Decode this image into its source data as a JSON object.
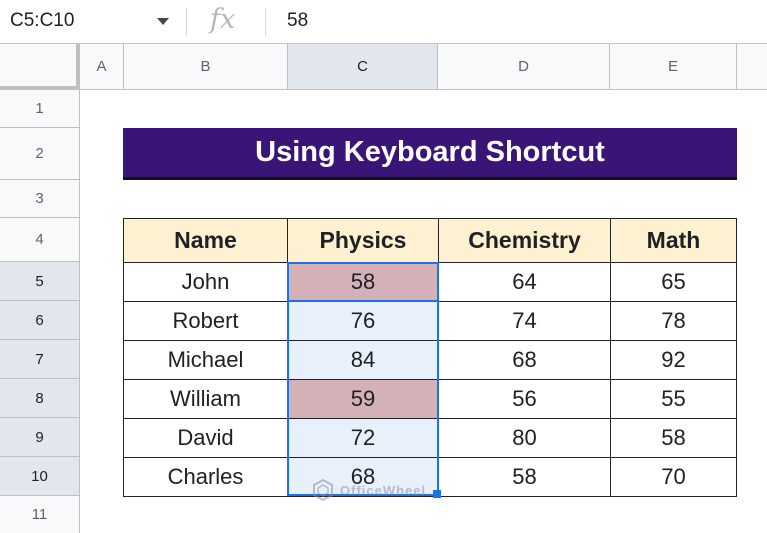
{
  "formula_bar": {
    "name_box": "C5:C10",
    "fx_label": "fx",
    "value": "58"
  },
  "columns": [
    "A",
    "B",
    "C",
    "D",
    "E"
  ],
  "rows": [
    "1",
    "2",
    "3",
    "4",
    "5",
    "6",
    "7",
    "8",
    "9",
    "10",
    "11"
  ],
  "title": "Using Keyboard Shortcut",
  "table": {
    "headers": [
      "Name",
      "Physics",
      "Chemistry",
      "Math"
    ],
    "rows": [
      [
        "John",
        "58",
        "64",
        "65"
      ],
      [
        "Robert",
        "76",
        "74",
        "78"
      ],
      [
        "Michael",
        "84",
        "68",
        "92"
      ],
      [
        "William",
        "59",
        "56",
        "55"
      ],
      [
        "David",
        "72",
        "80",
        "58"
      ],
      [
        "Charles",
        "68",
        "58",
        "70"
      ]
    ]
  },
  "watermark": "OfficeWheel",
  "colors": {
    "title_bg": "#3a1578",
    "header_bg": "#fdf1d2",
    "highlight": "#d3b1b6",
    "selection": "#1a73e8"
  }
}
